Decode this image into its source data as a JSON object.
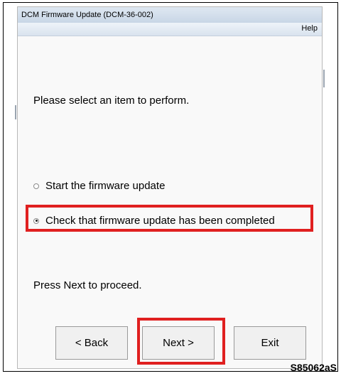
{
  "window": {
    "title": "DCM Firmware Update (DCM-36-002)",
    "menu_help": "Help"
  },
  "main": {
    "prompt": "Please select an item to perform.",
    "options": [
      {
        "label": "Start the firmware update",
        "selected": false
      },
      {
        "label": "Check that firmware update has been completed",
        "selected": true
      }
    ],
    "instruction": "Press Next to proceed."
  },
  "buttons": {
    "back": "< Back",
    "next": "Next >",
    "exit": "Exit"
  },
  "figure_code": "S85062aS",
  "colors": {
    "highlight": "#e02020",
    "titlebar": "#dfe8f2"
  }
}
